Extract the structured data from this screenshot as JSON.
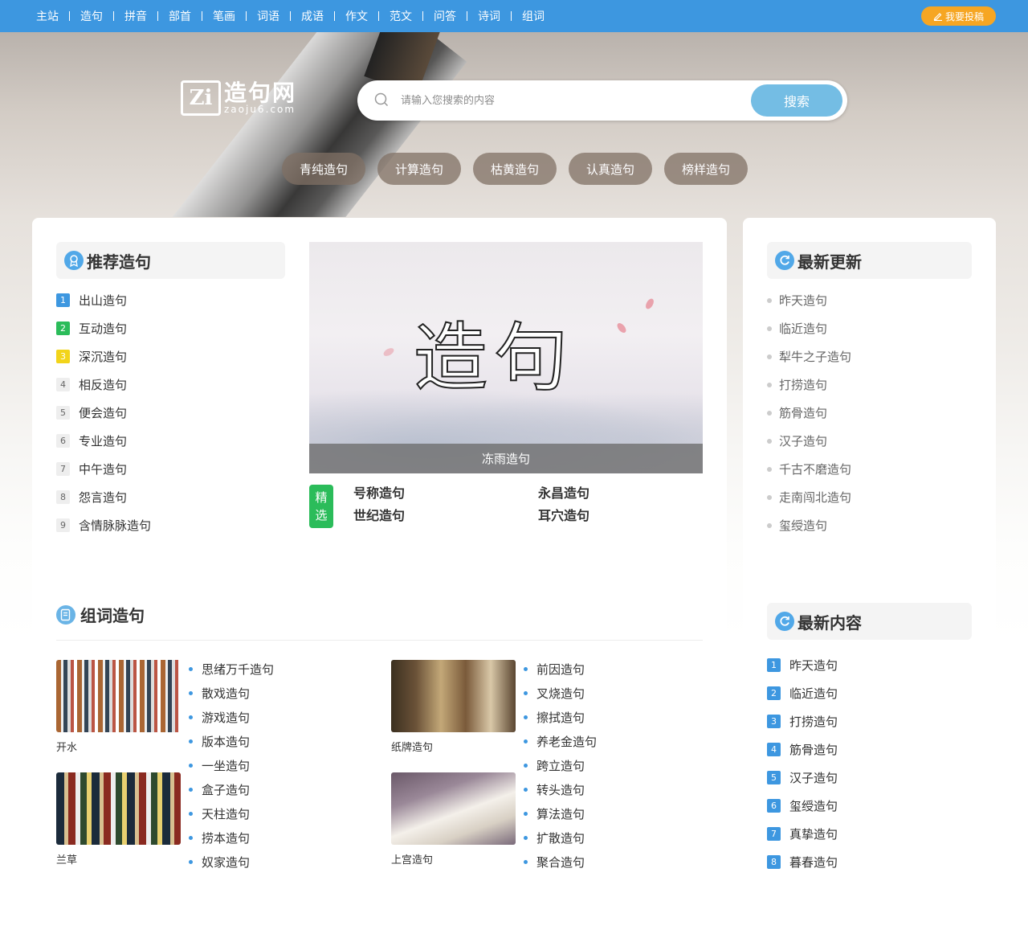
{
  "nav": {
    "items": [
      "主站",
      "造句",
      "拼音",
      "部首",
      "笔画",
      "词语",
      "成语",
      "作文",
      "范文",
      "问答",
      "诗词",
      "组词"
    ],
    "submit_label": "我要投稿"
  },
  "logo": {
    "mark": "Zi",
    "name": "造句网",
    "domain": "zaoju6.com"
  },
  "search": {
    "placeholder": "请输入您搜索的内容",
    "button": "搜索"
  },
  "hot_tags": [
    "青纯造句",
    "计算造句",
    "枯黄造句",
    "认真造句",
    "榜样造句"
  ],
  "recommend": {
    "title": "推荐造句",
    "items": [
      "出山造句",
      "互动造句",
      "深沉造句",
      "相反造句",
      "便会造句",
      "专业造句",
      "中午造句",
      "怨言造句",
      "含情脉脉造句"
    ]
  },
  "banner": {
    "big_text": "造句",
    "caption": "冻雨造句"
  },
  "featured": {
    "tag": [
      "精",
      "选"
    ],
    "links": [
      "号称造句",
      "永昌造句",
      "世纪造句",
      "耳穴造句"
    ]
  },
  "latest_updates": {
    "title": "最新更新",
    "items": [
      "昨天造句",
      "临近造句",
      "犁牛之子造句",
      "打捞造句",
      "筋骨造句",
      "汉子造句",
      "千古不磨造句",
      "走南闯北造句",
      "玺绶造句"
    ]
  },
  "word_section": {
    "title": "组词造句",
    "blocks": [
      {
        "caption": "开水",
        "links": [
          "思绪万千造句",
          "散戏造句",
          "游戏造句",
          "版本造句",
          "一坐造句"
        ]
      },
      {
        "caption": "兰草",
        "links": [
          "盒子造句",
          "天柱造句",
          "捞本造句",
          "奴家造句"
        ]
      },
      {
        "caption": "纸牌造句",
        "links": [
          "前因造句",
          "叉烧造句",
          "擦拭造句",
          "养老金造句",
          "跨立造句"
        ]
      },
      {
        "caption": "上宫造句",
        "links": [
          "转头造句",
          "算法造句",
          "扩散造句",
          "聚合造句"
        ]
      }
    ]
  },
  "latest_content": {
    "title": "最新内容",
    "items": [
      "昨天造句",
      "临近造句",
      "打捞造句",
      "筋骨造句",
      "汉子造句",
      "玺绶造句",
      "真挚造句",
      "暮春造句"
    ]
  },
  "colors": {
    "nav_bg": "#3d97e0",
    "submit_bg": "#f6a623",
    "featured_tag": "#2bbc5a",
    "search_btn": "#74bde4"
  },
  "icons": {
    "search": "search-icon",
    "submit": "pen-icon",
    "recommend": "award-icon",
    "updates": "refresh-icon",
    "word": "edit-doc-icon"
  }
}
